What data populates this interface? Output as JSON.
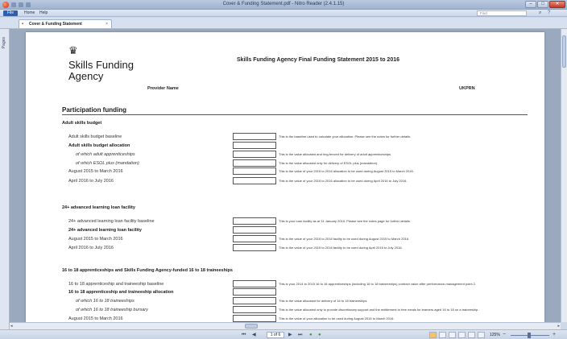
{
  "window": {
    "title": "Cover & Funding Statement.pdf - Nitro Reader (2.4.1.15)",
    "minimize": "–",
    "maximize": "□",
    "close": "✕"
  },
  "ribbon": {
    "file_tab": "File",
    "tabs": [
      "Home",
      "Help"
    ],
    "find_placeholder": "Find"
  },
  "doc_tab": {
    "label": "Cover & Funding Statement",
    "close": "×"
  },
  "left_panel": {
    "label": "Pages"
  },
  "document": {
    "logo_line1": "Skills Funding",
    "logo_line2": "Agency",
    "heading": "Skills Funding Agency Final Funding Statement 2015 to 2016",
    "provider_label": "Provider Name",
    "ukprn_label": "UKPRN",
    "section_title": "Participation funding",
    "groups": [
      {
        "heading": "Adult skills budget",
        "rows": [
          {
            "label": "Adult skills budget baseline",
            "style": "normal",
            "note": "This is the baseline used to calculate your allocation. Please see the notes for further details."
          },
          {
            "label": "Adult skills budget allocation",
            "style": "bold",
            "note": ""
          },
          {
            "label": "of which adult apprenticeships",
            "style": "ital",
            "note": "This is the value allocated and ring-fenced for delivery of adult apprenticeships."
          },
          {
            "label": "of which ESOL plus (mandation)",
            "style": "ital",
            "note": "This is the value allocated only for delivery of ESOL plus (mandation)."
          },
          {
            "label": "August 2015 to March 2016",
            "style": "normal",
            "note": "This is the value of your 2015 to 2016 allocation to be used during August 2015 to March 2016."
          },
          {
            "label": "April 2016 to July 2016",
            "style": "normal",
            "note": "This is the value of your 2015 to 2016 allocation to be used during April 2016 to July 2016."
          }
        ]
      },
      {
        "heading": "24+ advanced learning loan facility",
        "rows": [
          {
            "label": "24+ advanced learning loan facility baseline",
            "style": "normal",
            "note": "This is your loan facility as at 31 January 2015. Please see the notes page for further details."
          },
          {
            "label": "24+ advanced learning loan facility",
            "style": "bold",
            "note": ""
          },
          {
            "label": "August 2015 to March 2016",
            "style": "normal",
            "note": "This is the value of your 2015 to 2016 facility to be used during August 2015 to March 2016."
          },
          {
            "label": "April 2016 to July 2016",
            "style": "normal",
            "note": "This is the value of your 2015 to 2016 facility to be used during April 2016 to July 2016."
          }
        ]
      },
      {
        "heading": "16 to 18 apprenticeships and Skills Funding Agency-funded 16 to 18 traineeships",
        "rows": [
          {
            "label": "16 to 18 apprenticeship and traineeship baseline",
            "style": "normal",
            "note": "This is your 2014 to 2015 16 to 18 apprenticeships (including 16 to 18 traineeships) contract value after performance-management point 2."
          },
          {
            "label": "16 to 18 apprenticeship and traineeship allocation",
            "style": "bold",
            "note": ""
          },
          {
            "label": "of which 16 to 18 traineeships",
            "style": "ital",
            "note": "This is the value allocated for delivery of 16 to 18 traineeships."
          },
          {
            "label": "of which 16 to 18 traineeship bursary",
            "style": "ital",
            "note": "This is the value allocated only to provide discretionary support and the entitlement to free meals for learners aged 16 to 18 on a traineeship."
          },
          {
            "label": "August 2015 to March 2016",
            "style": "normal",
            "note": "This is the value of your allocation to be used during August 2015 to March 2016."
          }
        ]
      }
    ]
  },
  "statusbar": {
    "page_indicator": "1 of 6",
    "zoom": "125%",
    "zoom_out": "−",
    "zoom_in": "+"
  }
}
